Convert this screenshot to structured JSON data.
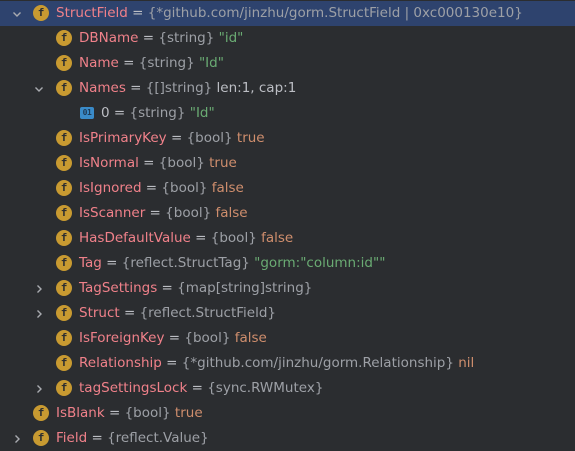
{
  "tree": {
    "rows": [
      {
        "name": "StructField",
        "eq": " = ",
        "type": "{*github.com/jinzhu/gorm.StructField | 0xc000130e10}",
        "value": ""
      },
      {
        "name": "DBName",
        "eq": " = ",
        "type": "{string}",
        "value": "\"id\""
      },
      {
        "name": "Name",
        "eq": " = ",
        "type": "{string}",
        "value": "\"Id\""
      },
      {
        "name": "Names",
        "eq": " = ",
        "type": "{[]string}",
        "value": "len:1, cap:1"
      },
      {
        "name": "0",
        "eq": " = ",
        "type": "{string}",
        "value": "\"Id\"",
        "index_icon": "01"
      },
      {
        "name": "IsPrimaryKey",
        "eq": " = ",
        "type": "{bool}",
        "value": "true"
      },
      {
        "name": "IsNormal",
        "eq": " = ",
        "type": "{bool}",
        "value": "true"
      },
      {
        "name": "IsIgnored",
        "eq": " = ",
        "type": "{bool}",
        "value": "false"
      },
      {
        "name": "IsScanner",
        "eq": " = ",
        "type": "{bool}",
        "value": "false"
      },
      {
        "name": "HasDefaultValue",
        "eq": " = ",
        "type": "{bool}",
        "value": "false"
      },
      {
        "name": "Tag",
        "eq": " = ",
        "type": "{reflect.StructTag}",
        "value": "\"gorm:\"column:id\"\""
      },
      {
        "name": "TagSettings",
        "eq": " = ",
        "type": "{map[string]string}",
        "value": ""
      },
      {
        "name": "Struct",
        "eq": " = ",
        "type": "{reflect.StructField}",
        "value": ""
      },
      {
        "name": "IsForeignKey",
        "eq": " = ",
        "type": "{bool}",
        "value": "false"
      },
      {
        "name": "Relationship",
        "eq": " = ",
        "type": "{*github.com/jinzhu/gorm.Relationship}",
        "value": "nil"
      },
      {
        "name": "tagSettingsLock",
        "eq": " = ",
        "type": "{sync.RWMutex}",
        "value": ""
      },
      {
        "name": "IsBlank",
        "eq": " = ",
        "type": "{bool}",
        "value": "true"
      },
      {
        "name": "Field",
        "eq": " = ",
        "type": "{reflect.Value}",
        "value": ""
      }
    ],
    "field_badge": "f"
  },
  "icons": {
    "expanded": "chevron-down-icon",
    "collapsed": "chevron-right-icon",
    "field": "field-f-icon",
    "index": "array-index-icon"
  },
  "colors": {
    "background": "#2b2d30",
    "selection": "#2e436e",
    "name": "#f0818a",
    "type": "#9da0a6",
    "string": "#6aab73",
    "keyword": "#cf8e6d",
    "badge": "#c89a31",
    "index_icon": "#3a8bc9"
  }
}
